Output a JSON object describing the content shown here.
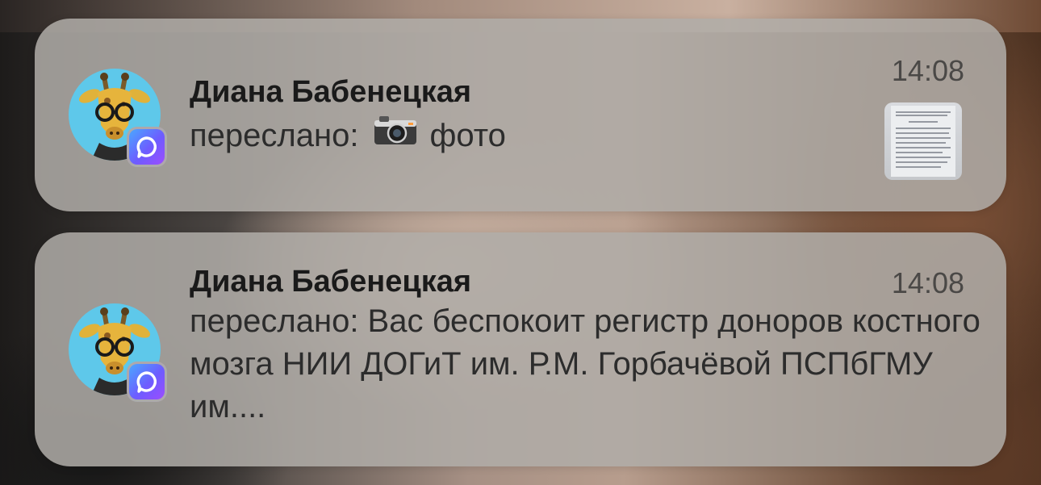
{
  "notifications": [
    {
      "sender": "Диана Бабенецкая",
      "time": "14:08",
      "message_prefix": "переслано:",
      "message_suffix": "фото",
      "attachment_icon": "camera-icon",
      "has_thumbnail": true
    },
    {
      "sender": "Диана Бабенецкая",
      "time": "14:08",
      "message": "переслано: Вас беспокоит регистр доноров костного мозга НИИ ДОГиТ им. Р.М. Горбачёвой ПСПбГМУ им...."
    }
  ],
  "icons": {
    "avatar": "giraffe-avatar",
    "app_badge": "messenger-app-icon"
  },
  "colors": {
    "card_bg": "#b0aca8",
    "sender_text": "#1a1a1a",
    "message_text": "#2c2c2c",
    "time_text": "#4a4846",
    "avatar_bg": "#5ec8ea",
    "badge_gradient": [
      "#4aa7ff",
      "#9c4dff"
    ]
  }
}
